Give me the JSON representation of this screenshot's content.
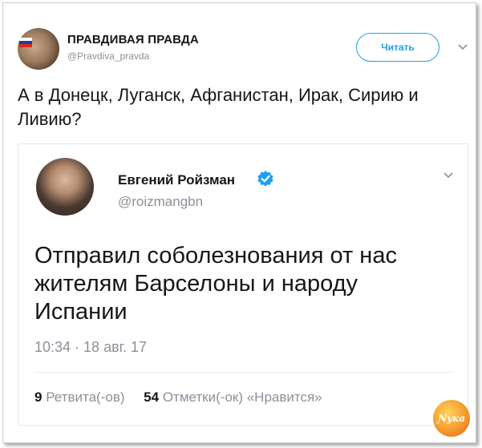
{
  "outer_tweet": {
    "author_name": "ПРАВДИВАЯ ПРАВДА",
    "author_handle": "@Pravdiva_pravda",
    "follow_label": "Читать",
    "text": "А в Донецк, Луганск, Афганистан, Ирак, Сирию и Ливию?"
  },
  "quoted_tweet": {
    "author_name": "Евгений Ройзман",
    "author_handle": "@roizmangbn",
    "text": "Отправил соболезнования от нас жителям Барселоны и народу Испании",
    "timestamp": "10:34 · 18 авг. 17",
    "retweets_count": "9",
    "retweets_label": "Ретвита(-ов)",
    "likes_count": "54",
    "likes_label": "Отметки(-ок) «Нравится»"
  },
  "watermark": "Ɲука",
  "colors": {
    "accent": "#1da1f2",
    "text": "#14171a",
    "muted": "#8a9198"
  },
  "icons": {
    "outer_menu": "chevron-down-icon",
    "inner_menu": "chevron-down-icon",
    "verified": "verified-badge-icon"
  }
}
